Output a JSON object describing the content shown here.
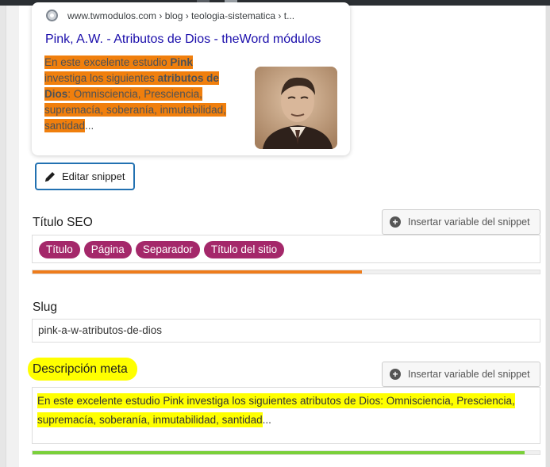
{
  "snippet": {
    "breadcrumb": "www.twmodulos.com › blog › teologia-sistematica › t...",
    "title": "Pink, A.W. - Atributos de Dios - theWord módulos",
    "description_parts": [
      "En este excelente estudio ",
      "Pink",
      " investiga los siguientes ",
      "atributos de Dios",
      ": Omnisciencia, Presciencia, supremacía, soberanía, inmutabilidad, santidad",
      "..."
    ],
    "icons": {
      "site": "globe-icon",
      "thumbnail": "author-portrait"
    },
    "highlight_color": "#f07f0d"
  },
  "edit_snippet_label": "Editar snippet",
  "seo_title": {
    "label": "Título SEO",
    "insert_button": "Insertar variable del snippet",
    "chips": [
      "Título",
      "Página",
      "Separador",
      "Título del sitio"
    ],
    "progress": 0.65,
    "progress_color": "#ee7c1b",
    "chip_color": "#a4286a"
  },
  "slug": {
    "label": "Slug",
    "value": "pink-a-w-atributos-de-dios"
  },
  "meta_description": {
    "label": "Descripción meta",
    "insert_button": "Insertar variable del snippet",
    "value_parts": [
      "En este excelente estudio Pink investiga los siguientes atributos de Dios: Omnisciencia, Presciencia, supremacía, soberanía, inmutabilidad, santidad",
      "..."
    ],
    "progress": 0.97,
    "progress_color": "#7ad03a",
    "highlight_color": "#ffff00"
  }
}
